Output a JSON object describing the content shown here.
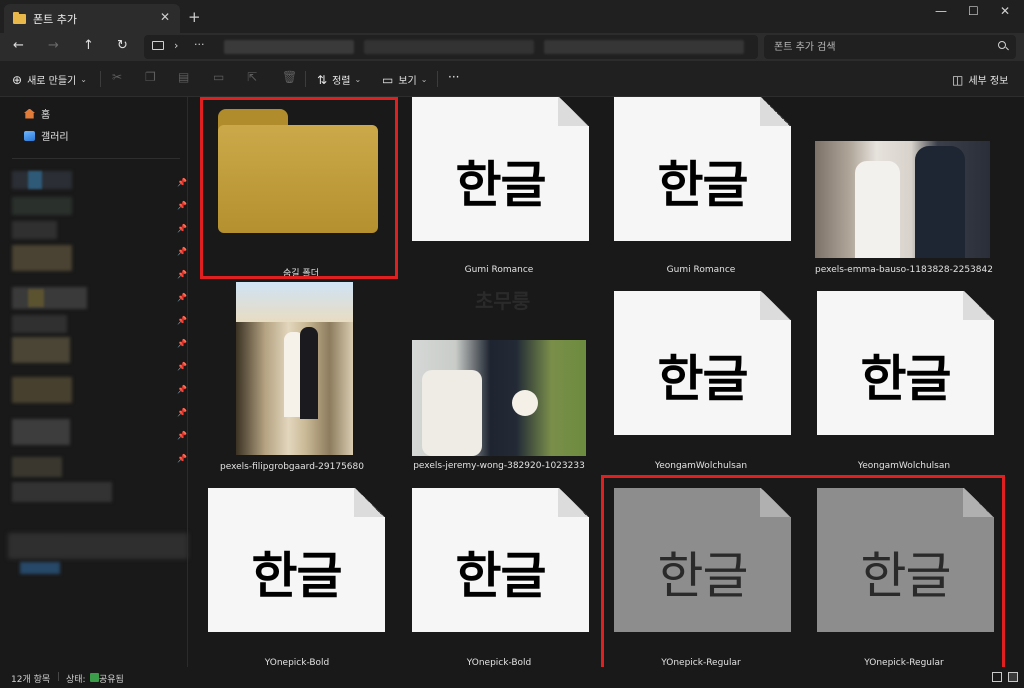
{
  "tab": {
    "title": "폰트 추가",
    "close": "✕",
    "new": "+"
  },
  "window": {
    "minimize": "—",
    "maximize": "☐",
    "close": "✕"
  },
  "nav": {
    "back": "←",
    "forward": "→",
    "up": "↑",
    "refresh": "↻"
  },
  "address": {
    "chevron": "›",
    "more": "···"
  },
  "search": {
    "placeholder": "폰트 추가 검색"
  },
  "toolbar": {
    "new_label": "새로 만들기",
    "sort_label": "정렬",
    "view_label": "보기",
    "more": "···",
    "details_label": "세부 정보"
  },
  "sidebar": {
    "home": "홈",
    "gallery": "갤러리"
  },
  "items": [
    {
      "label": "숨길 폴더",
      "type": "folder"
    },
    {
      "label": "Gumi Romance",
      "type": "font",
      "glyph": "한글"
    },
    {
      "label": "Gumi Romance",
      "type": "font",
      "glyph": "한글"
    },
    {
      "label": "pexels-emma-bauso-1183828-2253842",
      "type": "photo"
    },
    {
      "label": "pexels-filipgrobgaard-29175680",
      "type": "photo"
    },
    {
      "label": "pexels-jeremy-wong-382920-1023233",
      "type": "photo"
    },
    {
      "label": "YeongamWolchulsan",
      "type": "font",
      "glyph": "한글"
    },
    {
      "label": "YeongamWolchulsan",
      "type": "font",
      "glyph": "한글"
    },
    {
      "label": "YOnepick-Bold",
      "type": "font",
      "glyph": "한글"
    },
    {
      "label": "YOnepick-Bold",
      "type": "font",
      "glyph": "한글"
    },
    {
      "label": "YOnepick-Regular",
      "type": "font",
      "glyph": "한글"
    },
    {
      "label": "YOnepick-Regular",
      "type": "font",
      "glyph": "한글"
    }
  ],
  "status": {
    "count": "12개 항목",
    "state": "상태:",
    "shared": "공유됨"
  },
  "colors": {
    "highlight": "#e02020",
    "folder": "#c9a23a",
    "background": "#191919"
  }
}
